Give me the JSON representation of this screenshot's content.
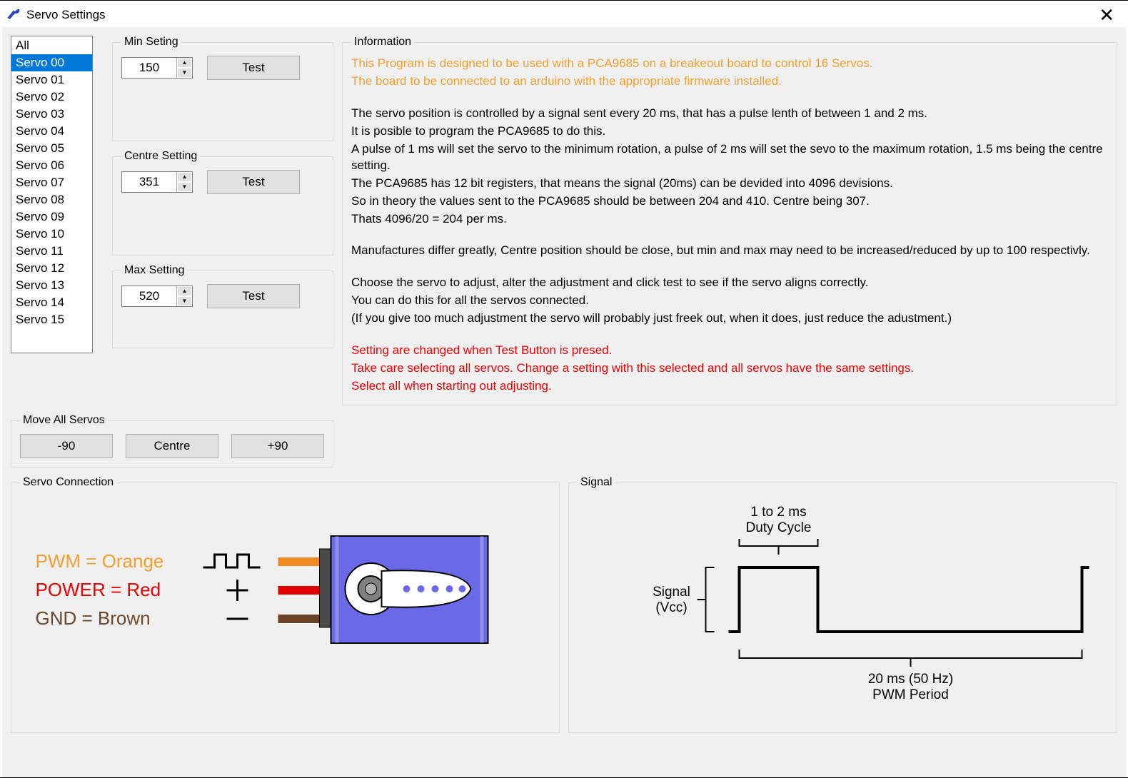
{
  "window": {
    "title": "Servo Settings"
  },
  "servoList": {
    "items": [
      "All",
      "Servo 00",
      "Servo 01",
      "Servo 02",
      "Servo 03",
      "Servo 04",
      "Servo 05",
      "Servo 06",
      "Servo 07",
      "Servo 08",
      "Servo 09",
      "Servo 10",
      "Servo 11",
      "Servo 12",
      "Servo 13",
      "Servo 14",
      "Servo 15"
    ],
    "selectedIndex": 1
  },
  "controls": {
    "min": {
      "legend": "Min Seting",
      "value": "150",
      "test": "Test"
    },
    "centre": {
      "legend": "Centre Setting",
      "value": "351",
      "test": "Test"
    },
    "max": {
      "legend": "Max Setting",
      "value": "520",
      "test": "Test"
    }
  },
  "moveAll": {
    "legend": "Move All Servos",
    "minus90": "-90",
    "centre": "Centre",
    "plus90": "+90"
  },
  "info": {
    "legend": "Information",
    "intro1": "This Program is designed to be used with a PCA9685 on a breakeout board to control 16 Servos.",
    "intro2": "The board to be connected to an arduino with the appropriate firmware installed.",
    "body": [
      "The servo position is controlled by a signal sent every 20 ms, that has a pulse lenth of between 1 and 2 ms.",
      "It is posible to program the PCA9685 to do this.",
      "A pulse of 1 ms will set the servo to the minimum rotation, a pulse of 2 ms will set the sevo to the maximum rotation, 1.5 ms being the centre setting.",
      "The PCA9685 has 12 bit registers, that means the signal (20ms) can be devided into 4096 devisions.",
      "So in theory the values sent to the PCA9685 should be between  204 and 410. Centre being 307.",
      "Thats 4096/20 = 204 per ms."
    ],
    "body2": [
      "Manufactures differ greatly, Centre position should be close, but min and max may need to be increased/reduced by up to 100 respectivly."
    ],
    "body3": [
      "Choose the servo to adjust, alter the adjustment and click test to see if the servo aligns correctly.",
      "You can do this for all the servos connected.",
      "(If you give too much adjustment the servo will probably just freek out, when it does, just reduce the adustment.)"
    ],
    "warn": [
      "Setting are changed when Test Button is presed.",
      "Take care selecting all servos. Change a setting with this selected and all servos have the same settings.",
      "Select all when starting out adjusting."
    ]
  },
  "connection": {
    "legend": "Servo Connection",
    "pwm": "PWM = Orange",
    "power": "POWER = Red",
    "gnd": "GND = Brown"
  },
  "signal": {
    "legend": "Signal",
    "duty1": "1 to 2 ms",
    "duty2": "Duty Cycle",
    "vcc1": "Signal",
    "vcc2": "(Vcc)",
    "period1": "20 ms (50 Hz)",
    "period2": "PWM Period"
  }
}
